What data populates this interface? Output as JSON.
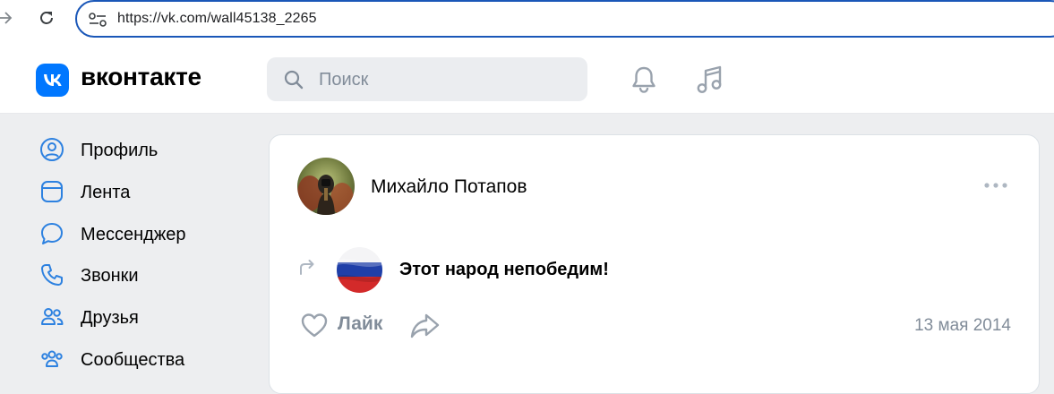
{
  "browser": {
    "url": "https://vk.com/wall45138_2265"
  },
  "header": {
    "brand": "вконтакте",
    "search_placeholder": "Поиск"
  },
  "sidebar": {
    "items": [
      {
        "label": "Профиль",
        "icon": "profile-icon"
      },
      {
        "label": "Лента",
        "icon": "feed-icon"
      },
      {
        "label": "Мессенджер",
        "icon": "messenger-icon"
      },
      {
        "label": "Звонки",
        "icon": "calls-icon"
      },
      {
        "label": "Друзья",
        "icon": "friends-icon"
      },
      {
        "label": "Сообщества",
        "icon": "communities-icon"
      }
    ]
  },
  "post": {
    "author": "Михайло Потапов",
    "repost_title": "Этот народ непобедим!",
    "like_label": "Лайк",
    "date": "13 мая 2014"
  },
  "colors": {
    "accent": "#0077ff",
    "icon": "#99a2ad",
    "sidebar_icon": "#2d81e0",
    "muted_text": "#818c99",
    "page_bg": "#edeef0",
    "url_border": "#1a57b8"
  }
}
